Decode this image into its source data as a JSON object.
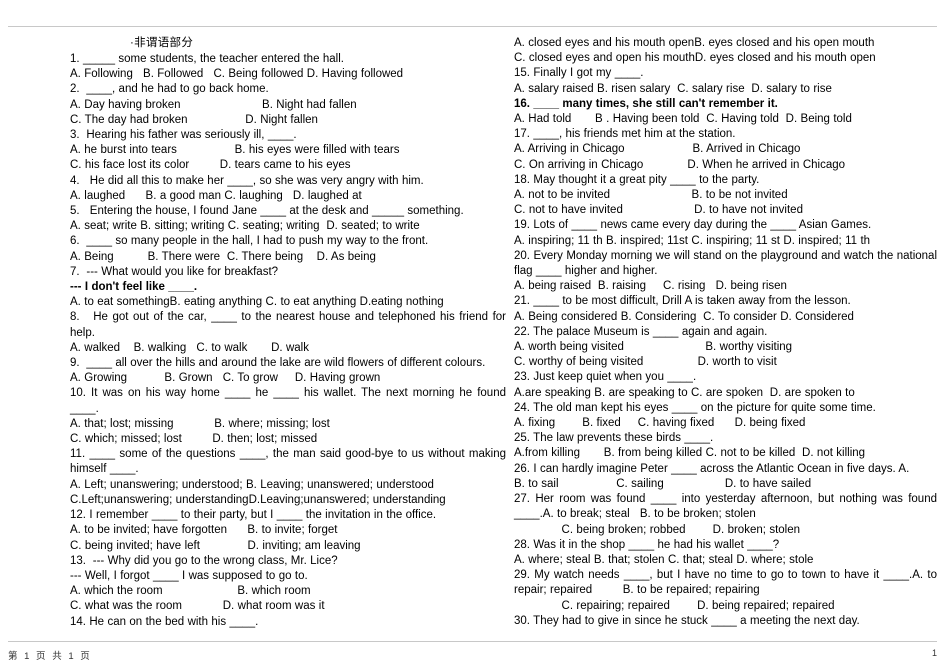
{
  "document": {
    "title": "·非谓语部分",
    "footer_left": "第 1 页 共 1 页",
    "footer_right": "1"
  },
  "left_column": [
    {
      "text": "1. _____ some students, the teacher entered the hall."
    },
    {
      "text": "A. Following   B. Followed   C. Being followed D. Having followed"
    },
    {
      "text": "2.  ____, and he had to go back home."
    },
    {
      "text": "A. Day having broken                        B. Night had fallen"
    },
    {
      "text": "C. The day had broken                 D. Night fallen"
    },
    {
      "text": "3.  Hearing his father was seriously ill, ____."
    },
    {
      "text": "A. he burst into tears                 B. his eyes were filled with tears"
    },
    {
      "text": "C. his face lost its color         D. tears came to his eyes"
    },
    {
      "text": "4.   He did all this to make her ____, so she was very angry with him."
    },
    {
      "text": "A. laughed      B. a good man C. laughing   D. laughed at"
    },
    {
      "text": "5.   Entering the house, I found Jane ____ at the desk and _____ something."
    },
    {
      "text": "A. seat; write B. sitting; writing C. seating; writing  D. seated; to write"
    },
    {
      "text": "6.  ____ so many people in the hall, I had to push my way to the front."
    },
    {
      "text": "A. Being          B. There were  C. There being    D. As being"
    },
    {
      "text": "7.  --- What would you like for breakfast?"
    },
    {
      "text": "--- I don't feel like ____.",
      "bold": true
    },
    {
      "text": "A. to eat somethingB. eating anything C. to eat anything D.eating nothing"
    },
    {
      "text": "8.   He got out of the car, ____ to the nearest house and telephoned his friend for help."
    },
    {
      "text": "A. walked    B. walking   C. to walk       D. walk"
    },
    {
      "text": "9.  ____ all over the hills and around the lake are wild flowers of different colours."
    },
    {
      "text": "A. Growing           B. Grown   C. To grow     D. Having grown"
    },
    {
      "text": "10. It was on his way home ____ he ____ his wallet. The next morning he found ____."
    },
    {
      "text": "A. that; lost; missing            B. where; missing; lost"
    },
    {
      "text": "C. which; missed; lost         D. then; lost; missed"
    },
    {
      "text": "11. ____ some of the questions ____, the man said good-bye to us without making himself ____."
    },
    {
      "text": "A. Left; unanswering; understood; B. Leaving; unanswered; understood"
    },
    {
      "text": "C.Left;unanswering; understandingD.Leaving;unanswered; understanding"
    },
    {
      "text": "12. I remember ____ to their party, but I ____ the invitation in the office."
    },
    {
      "text": "A. to be invited; have forgotten      B. to invite; forget"
    },
    {
      "text": "C. being invited; have left              D. inviting; am leaving"
    },
    {
      "text": "13.  --- Why did you go to the wrong class, Mr. Lice?"
    },
    {
      "text": "--- Well, I forgot ____ I was supposed to go to."
    },
    {
      "text": "A. which the room                      B. which room"
    },
    {
      "text": "C. what was the room            D. what room was it"
    },
    {
      "text": "14. He can on the bed with his ____."
    }
  ],
  "right_column": [
    {
      "text": "A. closed eyes and his mouth openB. eyes closed and his open mouth"
    },
    {
      "text": "C. closed eyes and open his mouthD. eyes closed and his mouth open"
    },
    {
      "text": "15. Finally I got my ____."
    },
    {
      "text": "A. salary raised B. risen salary  C. salary rise  D. salary to rise"
    },
    {
      "text": "16. ____ many times, she still can't remember it.",
      "bold": true
    },
    {
      "text": "A. Had told       B . Having been told  C. Having told  D. Being told"
    },
    {
      "text": "17. ____, his friends met him at the station."
    },
    {
      "text": "A. Arriving in Chicago                    B. Arrived in Chicago"
    },
    {
      "text": "C. On arriving in Chicago             D. When he arrived in Chicago"
    },
    {
      "text": "18. May thought it a great pity ____ to the party."
    },
    {
      "text": "A. not to be invited                        B. to be not invited"
    },
    {
      "text": "C. not to have invited                     D. to have not invited"
    },
    {
      "text": "19. Lots of ____ news came every day during the ____ Asian Games."
    },
    {
      "text": "A. inspiring; 11 th B. inspired; 11st C. inspiring; 11 st D. inspired; 11 th"
    },
    {
      "text": "20. Every Monday morning we will stand on the playground and watch the national flag ____ higher and higher."
    },
    {
      "text": "A. being raised  B. raising     C. rising   D. being risen"
    },
    {
      "text": "21. ____ to be most difficult, Drill A is taken away from the lesson."
    },
    {
      "text": "A. Being considered B. Considering  C. To consider D. Considered"
    },
    {
      "text": "22. The palace Museum is ____ again and again."
    },
    {
      "text": "A. worth being visited                        B. worthy visiting"
    },
    {
      "text": "C. worthy of being visited                D. worth to visit"
    },
    {
      "text": "23. Just keep quiet when you ____."
    },
    {
      "text": "A.are speaking B. are speaking to C. are spoken  D. are spoken to"
    },
    {
      "text": "24. The old man kept his eyes ____ on the picture for quite some time."
    },
    {
      "text": "A. fixing        B. fixed     C. having fixed      D. being fixed"
    },
    {
      "text": "25. The law prevents these birds ____."
    },
    {
      "text": "A.from killing       B. from being killed C. not to be killed  D. not killing"
    },
    {
      "text": "26. I can hardly imagine Peter ____ across the Atlantic Ocean in five days. A."
    },
    {
      "text": "B. to sail                 C. sailing                  D. to have sailed"
    },
    {
      "text": "27. Her room was found ____ into yesterday afternoon, but nothing was found ____.A. to break; steal   B. to be broken; stolen"
    },
    {
      "text": "              C. being broken; robbed        D. broken; stolen"
    },
    {
      "text": "28. Was it in the shop ____ he had his wallet ____?"
    },
    {
      "text": "A. where; steal B. that; stolen C. that; steal D. where; stole"
    },
    {
      "text": "29. My watch needs ____, but I have no time to go to town to have it ____.A. to repair; repaired         B. to be repaired; repairing"
    },
    {
      "text": "              C. repairing; repaired        D. being repaired; repaired"
    },
    {
      "text": "30. They had to give in since he stuck ____ a meeting the next day."
    }
  ]
}
